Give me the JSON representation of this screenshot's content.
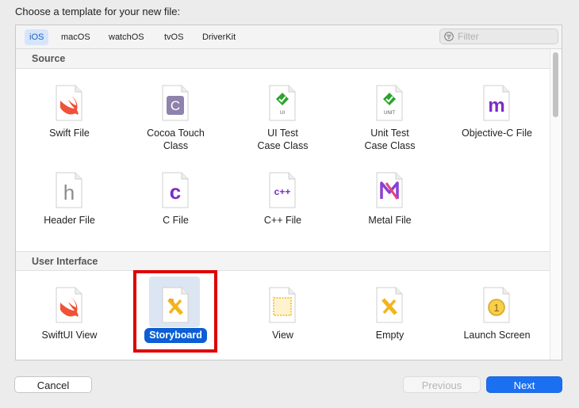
{
  "dialog": {
    "title": "Choose a template for your new file:"
  },
  "platform_tabs": [
    {
      "label": "iOS",
      "active": true
    },
    {
      "label": "macOS",
      "active": false
    },
    {
      "label": "watchOS",
      "active": false
    },
    {
      "label": "tvOS",
      "active": false
    },
    {
      "label": "DriverKit",
      "active": false
    }
  ],
  "filter": {
    "placeholder": "Filter",
    "icon": "filter-icon"
  },
  "sections": {
    "source": {
      "title": "Source",
      "items": [
        {
          "label": "Swift File",
          "icon": "swift-file-icon"
        },
        {
          "label": "Cocoa Touch Class",
          "icon": "cocoa-touch-class-icon",
          "glyph": "C"
        },
        {
          "label": "UI Test Case Class",
          "icon": "ui-test-case-icon",
          "glyph": "UI"
        },
        {
          "label": "Unit Test Case Class",
          "icon": "unit-test-case-icon",
          "glyph": "UNIT"
        },
        {
          "label": "Objective-C File",
          "icon": "objective-c-file-icon",
          "glyph": "m"
        },
        {
          "label": "Header File",
          "icon": "header-file-icon",
          "glyph": "h"
        },
        {
          "label": "C File",
          "icon": "c-file-icon",
          "glyph": "c"
        },
        {
          "label": "C++ File",
          "icon": "cpp-file-icon",
          "glyph": "c++"
        },
        {
          "label": "Metal File",
          "icon": "metal-file-icon"
        }
      ]
    },
    "user_interface": {
      "title": "User Interface",
      "items": [
        {
          "label": "SwiftUI View",
          "icon": "swiftui-view-icon"
        },
        {
          "label": "Storyboard",
          "icon": "storyboard-icon",
          "selected": true
        },
        {
          "label": "View",
          "icon": "view-xib-icon"
        },
        {
          "label": "Empty",
          "icon": "empty-xib-icon"
        },
        {
          "label": "Launch Screen",
          "icon": "launch-screen-icon",
          "glyph": "1"
        }
      ]
    }
  },
  "buttons": {
    "cancel": "Cancel",
    "previous": "Previous",
    "next": "Next"
  },
  "colors": {
    "accent": "#1a70f0",
    "selection": "#0c5ed4",
    "highlight_box": "#e00000"
  }
}
